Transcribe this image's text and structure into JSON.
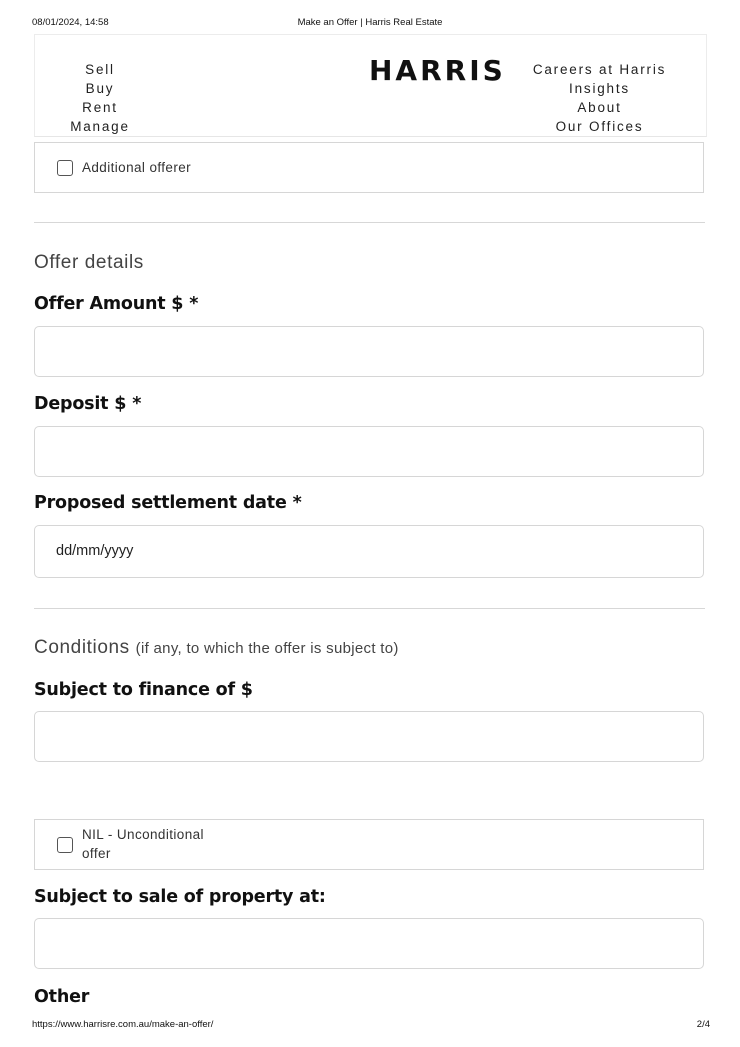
{
  "print": {
    "date": "08/01/2024, 14:58",
    "title": "Make an Offer | Harris Real Estate",
    "url": "https://www.harrisre.com.au/make-an-offer/",
    "page": "2/4"
  },
  "header": {
    "logo": "HARRIS",
    "nav_left": [
      "Sell",
      "Buy",
      "Rent",
      "Manage"
    ],
    "nav_right": [
      "Careers at Harris",
      "Insights",
      "About",
      "Our Offices"
    ]
  },
  "form": {
    "additional_offerer": {
      "label": "Additional offerer",
      "checked": false
    },
    "offer_details_title": "Offer details",
    "offer_amount": {
      "label": "Offer Amount $",
      "required_mark": "*",
      "value": ""
    },
    "deposit": {
      "label": "Deposit $",
      "required_mark": "*",
      "value": ""
    },
    "settlement": {
      "label": "Proposed settlement date",
      "required_mark": "*",
      "placeholder": "dd/mm/yyyy"
    },
    "conditions_title": "Conditions",
    "conditions_note": "(if any, to which the offer is subject to)",
    "finance": {
      "label": "Subject to finance of $",
      "value": ""
    },
    "unconditional": {
      "label_line1": "NIL - Unconditional",
      "label_line2": "offer",
      "checked": false
    },
    "sale_of_property": {
      "label": "Subject to sale of property at:",
      "value": ""
    },
    "other": {
      "label": "Other"
    }
  }
}
